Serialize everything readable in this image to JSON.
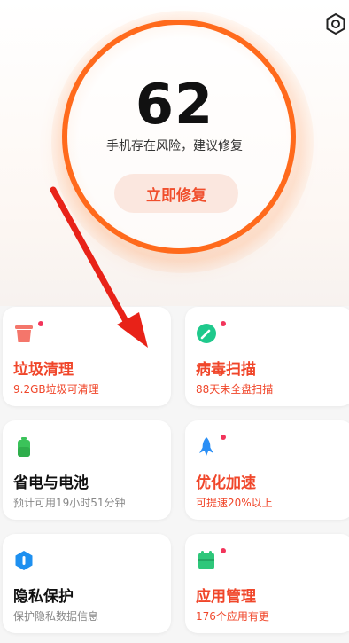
{
  "header": {
    "settings_icon": "gear-icon"
  },
  "score_panel": {
    "score": "62",
    "status": "手机存在风险，建议修复",
    "fix_button": "立即修复",
    "accent": "#ff6a1c"
  },
  "cards": [
    {
      "title": "垃圾清理",
      "subtitle": "9.2GB垃圾可清理",
      "icon": "trash-icon",
      "has_dot": true
    },
    {
      "title": "病毒扫描",
      "subtitle": "88天未全盘扫描",
      "icon": "virus-scan-icon",
      "has_dot": true
    },
    {
      "title": "省电与电池",
      "subtitle": "预计可用19小时51分钟",
      "icon": "battery-icon",
      "has_dot": false
    },
    {
      "title": "优化加速",
      "subtitle": "可提速20%以上",
      "icon": "rocket-icon",
      "has_dot": true
    },
    {
      "title": "隐私保护",
      "subtitle": "保护隐私数据信息",
      "icon": "privacy-shield-icon",
      "has_dot": false
    },
    {
      "title": "应用管理",
      "subtitle": "176个应用有更",
      "icon": "app-manage-icon",
      "has_dot": true
    }
  ],
  "colors": {
    "warning_red": "#f0462a",
    "notify_dot": "#f2355b",
    "annotation_arrow": "#e82218"
  }
}
